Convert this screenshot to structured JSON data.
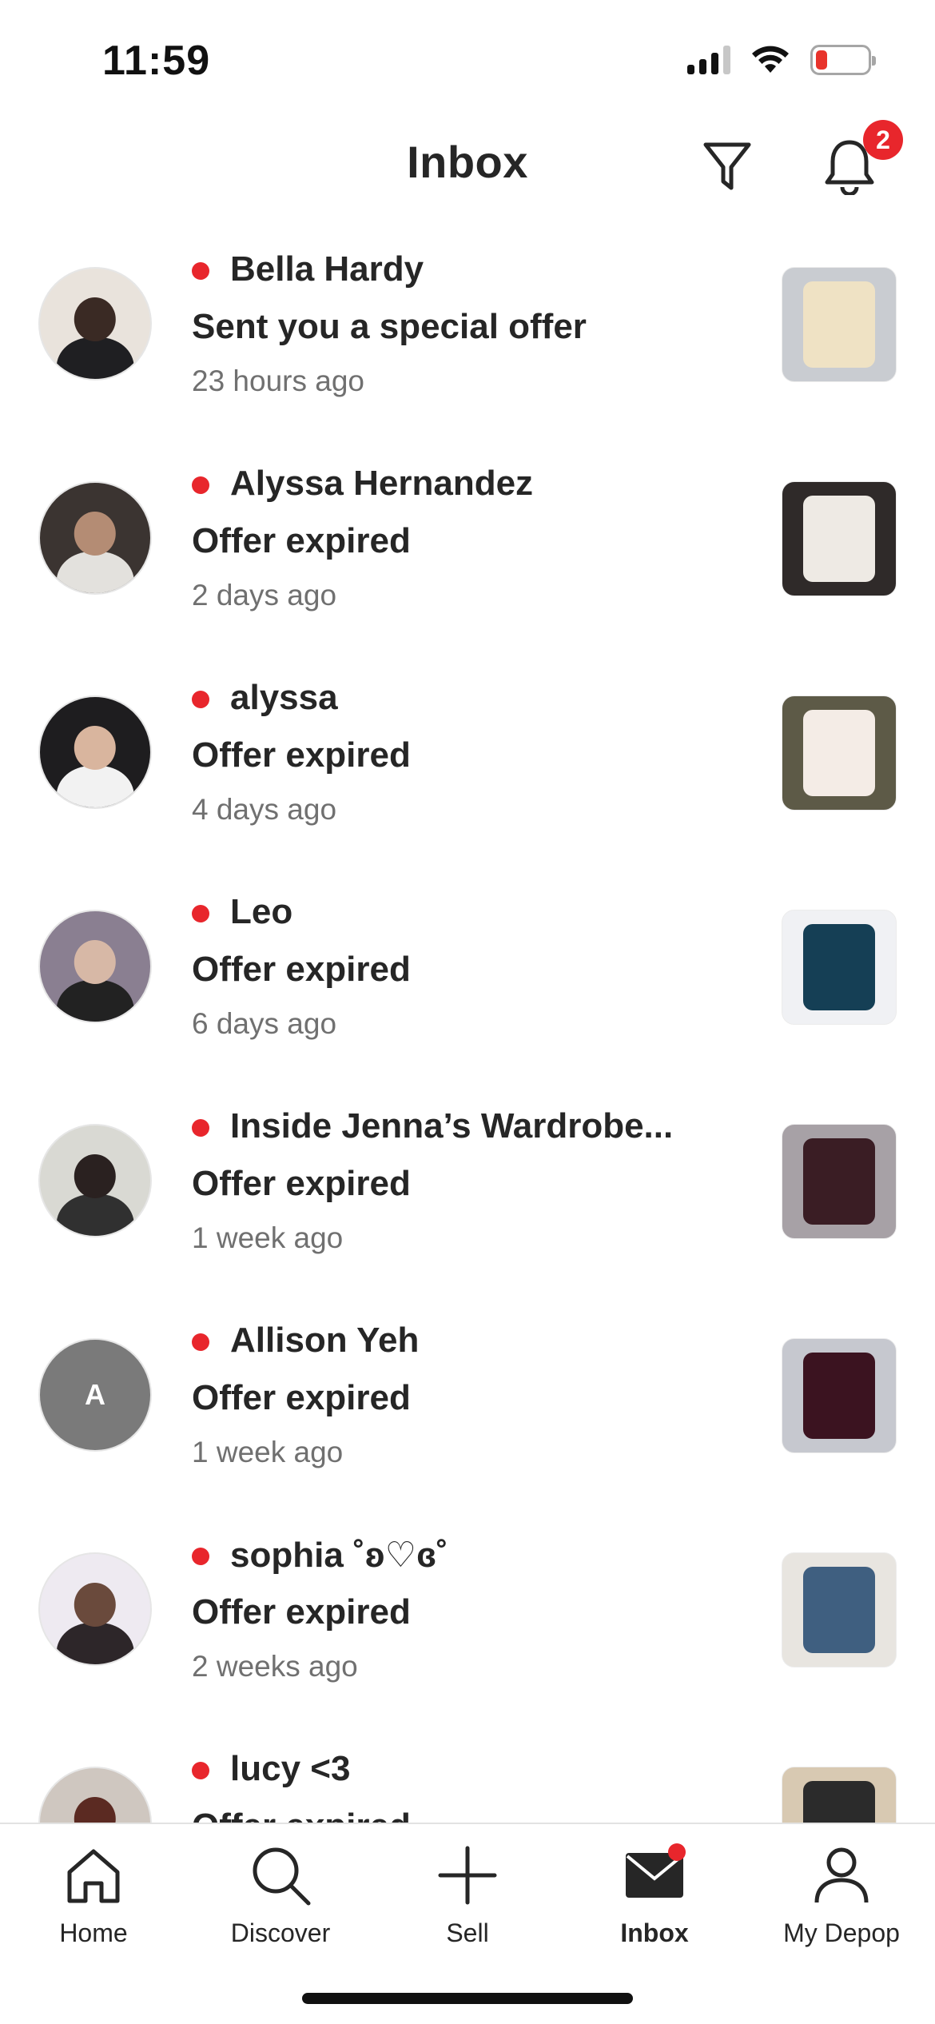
{
  "status_bar": {
    "time": "11:59"
  },
  "header": {
    "title": "Inbox",
    "filter_icon": "filter-icon",
    "bell_icon": "bell-icon",
    "notification_count": "2"
  },
  "conversations": [
    {
      "sender": "Bella Hardy",
      "message": "Sent you a special offer",
      "time": "23 hours ago",
      "unread": true,
      "avatar_colors": [
        "#e9e3dc",
        "#3a2a24",
        "#1f1f22"
      ],
      "thumb_colors": [
        "#c9ccd1",
        "#efe2c4"
      ]
    },
    {
      "sender": "Alyssa Hernandez",
      "message": "Offer expired",
      "time": "2 days ago",
      "unread": true,
      "avatar_colors": [
        "#3b3431",
        "#b48c74",
        "#e3e1dd"
      ],
      "thumb_colors": [
        "#2f2a29",
        "#eeeae4"
      ]
    },
    {
      "sender": "alyssa",
      "message": "Offer expired",
      "time": "4 days ago",
      "unread": true,
      "avatar_colors": [
        "#1e1d1f",
        "#d9b59e",
        "#f2f2f2"
      ],
      "thumb_colors": [
        "#5d5a47",
        "#f4ece6"
      ]
    },
    {
      "sender": "Leo",
      "message": "Offer expired",
      "time": "6 days ago",
      "unread": true,
      "avatar_colors": [
        "#8a7f91",
        "#d7b8a6",
        "#222222"
      ],
      "thumb_colors": [
        "#f0f1f4",
        "#153f55"
      ]
    },
    {
      "sender": "Inside Jenna’s Wardrobe...",
      "message": "Offer expired",
      "time": "1 week ago",
      "unread": true,
      "avatar_colors": [
        "#d9d9d3",
        "#2a2120",
        "#303030"
      ],
      "thumb_colors": [
        "#a7a1a6",
        "#3a1d24"
      ]
    },
    {
      "sender": "Allison Yeh",
      "message": "Offer expired",
      "time": "1 week ago",
      "unread": true,
      "avatar_letter": "A",
      "avatar_colors": [
        "#7a7a7a"
      ],
      "thumb_colors": [
        "#c6c8cf",
        "#3b1320"
      ]
    },
    {
      "sender": "sophia ˚ʚ♡ɞ˚",
      "message": "Offer expired",
      "time": "2 weeks ago",
      "unread": true,
      "avatar_colors": [
        "#eeeaf1",
        "#6a4a3c",
        "#2d2629"
      ],
      "thumb_colors": [
        "#e8e5e0",
        "#3f5f80"
      ]
    },
    {
      "sender": "lucy <3",
      "message": "Offer expired",
      "time": "",
      "unread": true,
      "avatar_colors": [
        "#cfc7c0",
        "#5b2a22",
        "#201b1b"
      ],
      "thumb_colors": [
        "#d8c9b2",
        "#2b2b2b"
      ]
    }
  ],
  "bottom_nav": {
    "items": [
      {
        "label": "Home",
        "icon": "home-icon",
        "active": false
      },
      {
        "label": "Discover",
        "icon": "search-icon",
        "active": false
      },
      {
        "label": "Sell",
        "icon": "plus-icon",
        "active": false
      },
      {
        "label": "Inbox",
        "icon": "mail-icon",
        "active": true
      },
      {
        "label": "My Depop",
        "icon": "profile-icon",
        "active": false
      }
    ]
  },
  "colors": {
    "accent_red": "#e8262c",
    "text_primary": "#262626",
    "text_secondary": "#707070"
  }
}
